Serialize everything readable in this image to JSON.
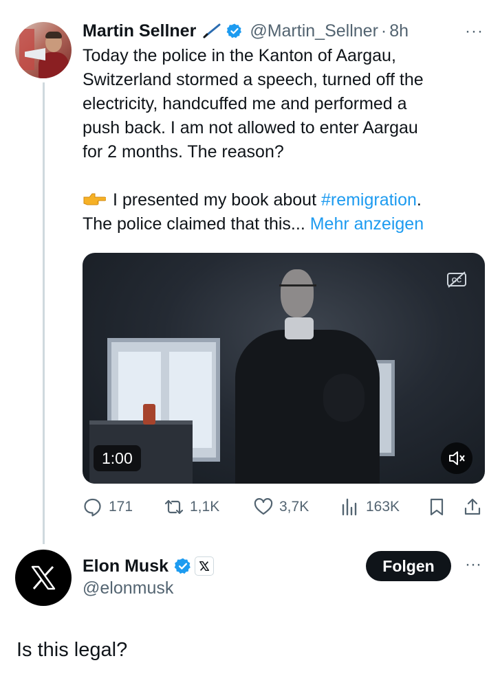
{
  "tweet": {
    "author_name": "Martin Sellner",
    "author_handle": "@Martin_Sellner",
    "separator": "·",
    "time": "8h",
    "more_glyph": "···",
    "pen_emoji": "pen-emoji",
    "text_lines": [
      "Today the police in the Kanton of Aargau,",
      "Switzerland stormed a speech, turned off the",
      "electricity, handcuffed me and performed a",
      "push back. I am not allowed to enter Aargau",
      "for 2 months. The reason?"
    ],
    "line6_text": "I presented my book about ",
    "hashtag": "#remigration",
    "line6_end": ".",
    "line7_text": "The police claimed that this... ",
    "show_more": "Mehr anzeigen",
    "video": {
      "duration": "1:00",
      "icons": [
        "captions-icon",
        "mute-icon"
      ]
    },
    "actions": {
      "replies": "171",
      "reposts": "1,1K",
      "likes": "3,7K",
      "views": "163K"
    }
  },
  "reply": {
    "author_name": "Elon Musk",
    "author_handle": "@elonmusk",
    "follow_label": "Folgen",
    "more_glyph": "···",
    "text": "Is this legal?"
  },
  "colors": {
    "link": "#1d9bf0",
    "verified": "#1d9bf0",
    "secondary_text": "#536471",
    "primary_text": "#0f1419"
  }
}
